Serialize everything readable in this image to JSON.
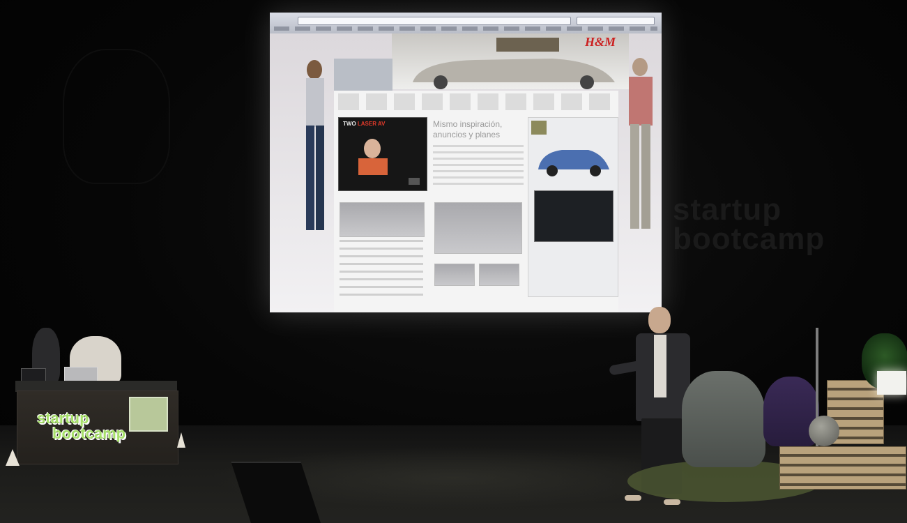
{
  "screen": {
    "brand_ad": "H&M",
    "video_title_white": "TWO ",
    "video_title_red": "LASER AV",
    "headline": "Mismo inspiración, anuncios y planes"
  },
  "table_banner": {
    "line1": "startup",
    "line2": "bootcamp"
  },
  "backdrop": {
    "line1": "startup",
    "line2": "bootcamp"
  },
  "colors": {
    "logo_green": "#a7e06a",
    "hm_red": "#cc1f1f"
  }
}
